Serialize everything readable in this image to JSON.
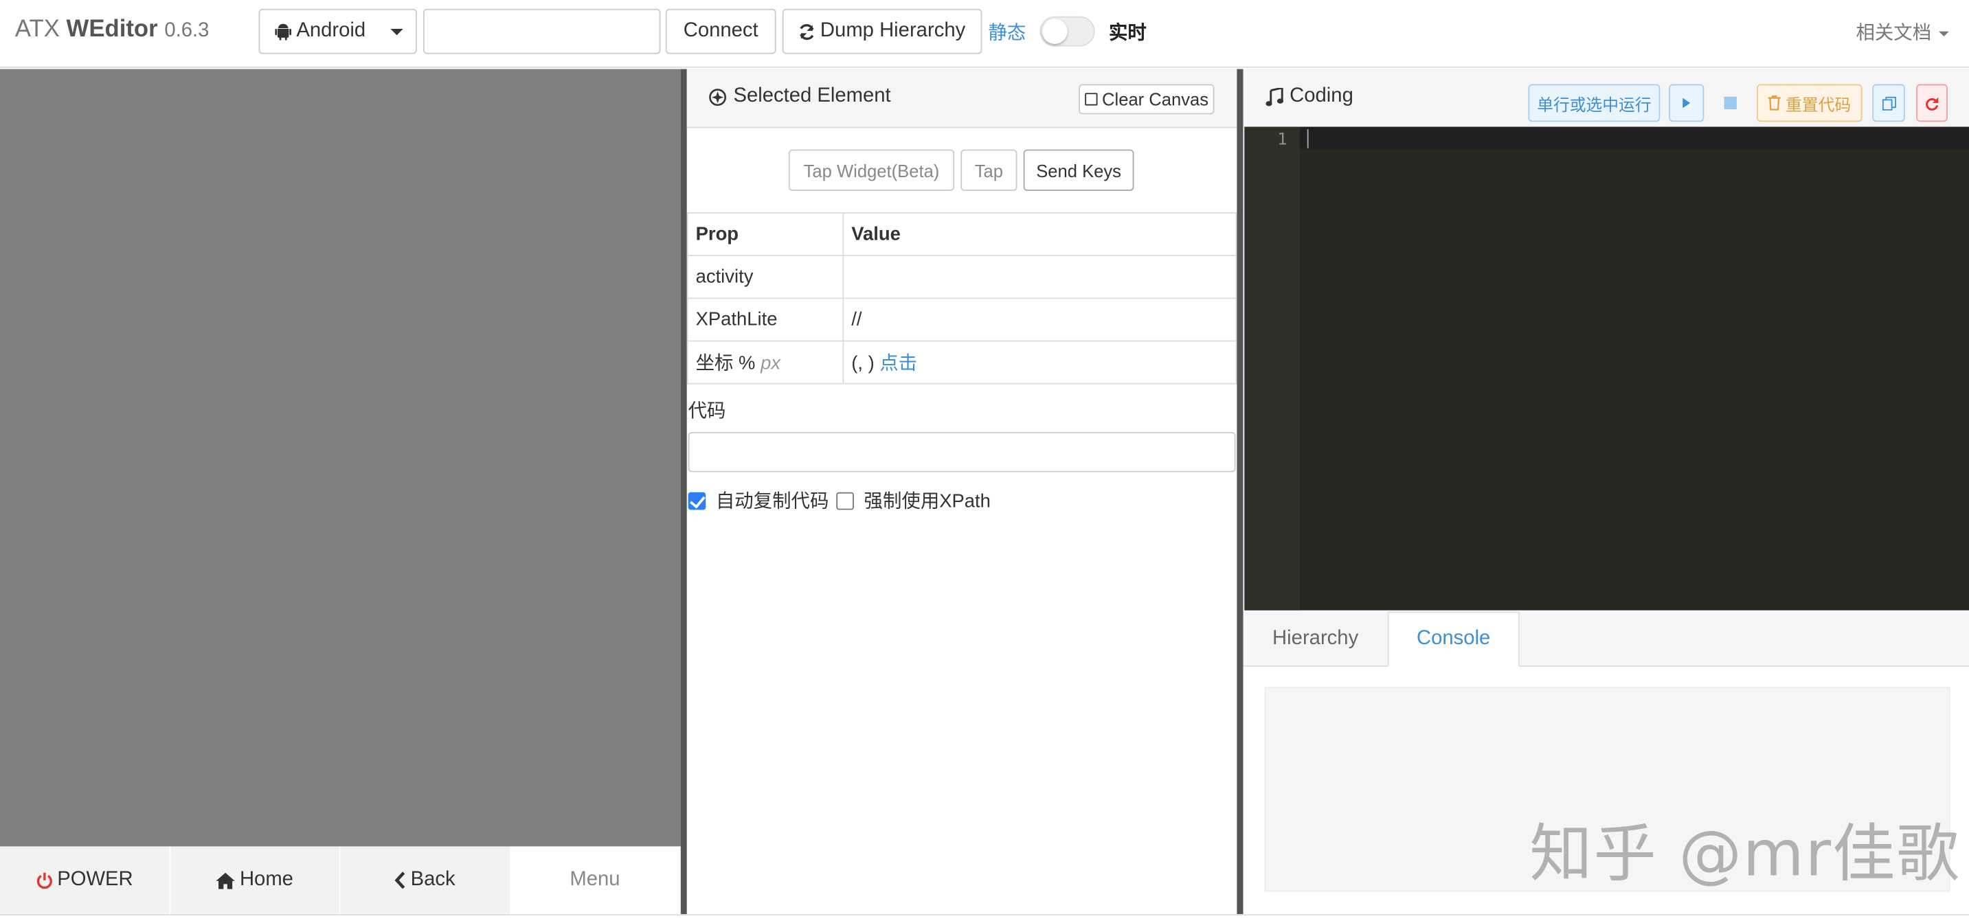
{
  "navbar": {
    "brand_prefix": "ATX",
    "brand_name": "WEditor",
    "version": "0.6.3",
    "platform": "Android",
    "serial_value": "",
    "connect_label": "Connect",
    "dump_label": "Dump Hierarchy",
    "static_label": "静态",
    "realtime_label": "实时",
    "docs_label": "相关文档"
  },
  "device_bar": {
    "power": "POWER",
    "home": "Home",
    "back": "Back",
    "menu": "Menu"
  },
  "selected": {
    "title": "Selected Element",
    "clear_canvas": "Clear Canvas",
    "tap_widget": "Tap Widget(Beta)",
    "tap": "Tap",
    "send_keys": "Send Keys",
    "table": {
      "header_prop": "Prop",
      "header_value": "Value",
      "rows": [
        {
          "prop": "activity",
          "value": ""
        },
        {
          "prop": "XPathLite",
          "value": "//"
        },
        {
          "prop": "坐标 %",
          "prop_unit": "px",
          "value": "(, )",
          "link": "点击"
        }
      ]
    },
    "code_label": "代码",
    "code_value": "",
    "auto_copy_label": "自动复制代码",
    "auto_copy_checked": true,
    "force_xpath_label": "强制使用XPath",
    "force_xpath_checked": false
  },
  "coding": {
    "title": "Coding",
    "run_line_label": "单行或选中运行",
    "reset_label": "重置代码",
    "line_numbers": [
      "1"
    ],
    "tabs": [
      "Hierarchy",
      "Console"
    ],
    "active_tab": "Console"
  },
  "watermark": "知乎 @mr佳歌",
  "colors": {
    "accent": "#3a8fd6",
    "editor_bg": "#272822",
    "screen_bg": "#808080",
    "power_red": "#e3342f",
    "reset_orange": "#e0a040"
  }
}
